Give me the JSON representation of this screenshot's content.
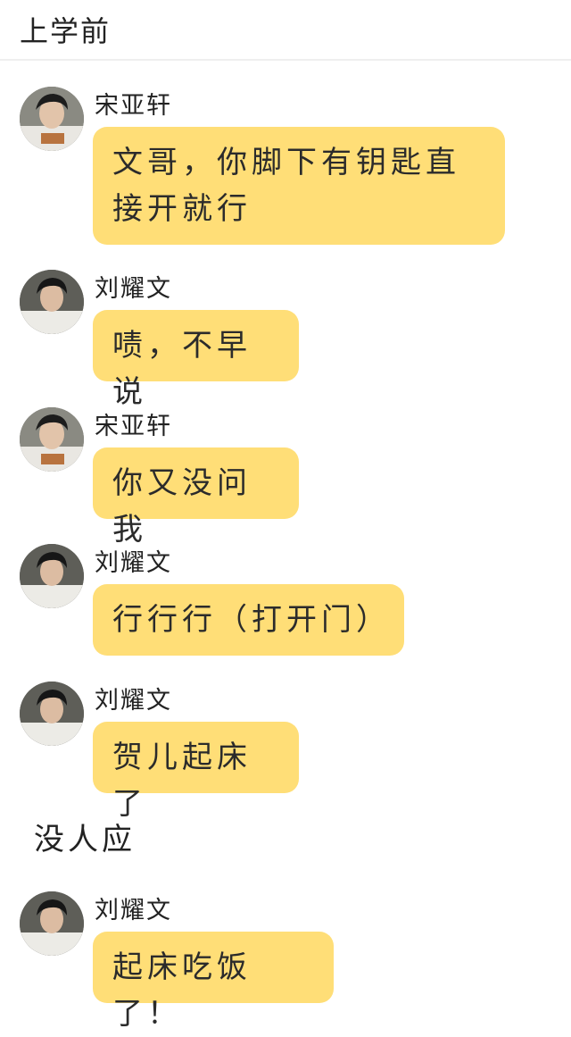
{
  "header": {
    "title": "上学前"
  },
  "messages": [
    {
      "sender": "宋亚轩",
      "text": "文哥，你脚下有钥匙直接开就行",
      "avatar": "avatar-photo-song"
    },
    {
      "sender": "刘耀文",
      "text": "啧，不早说",
      "avatar": "avatar-photo-liu"
    },
    {
      "sender": "宋亚轩",
      "text": "你又没问我",
      "avatar": "avatar-photo-song"
    },
    {
      "sender": "刘耀文",
      "text": "行行行（打开门）",
      "avatar": "avatar-photo-liu"
    },
    {
      "sender": "刘耀文",
      "text": "贺儿起床了",
      "avatar": "avatar-photo-liu"
    },
    {
      "sender": "刘耀文",
      "text": "起床吃饭了！",
      "avatar": "avatar-photo-liu"
    }
  ],
  "narration": "没人应",
  "colors": {
    "bubble": "#ffde77",
    "background": "#ffffff",
    "text": "#2b2b2b"
  }
}
